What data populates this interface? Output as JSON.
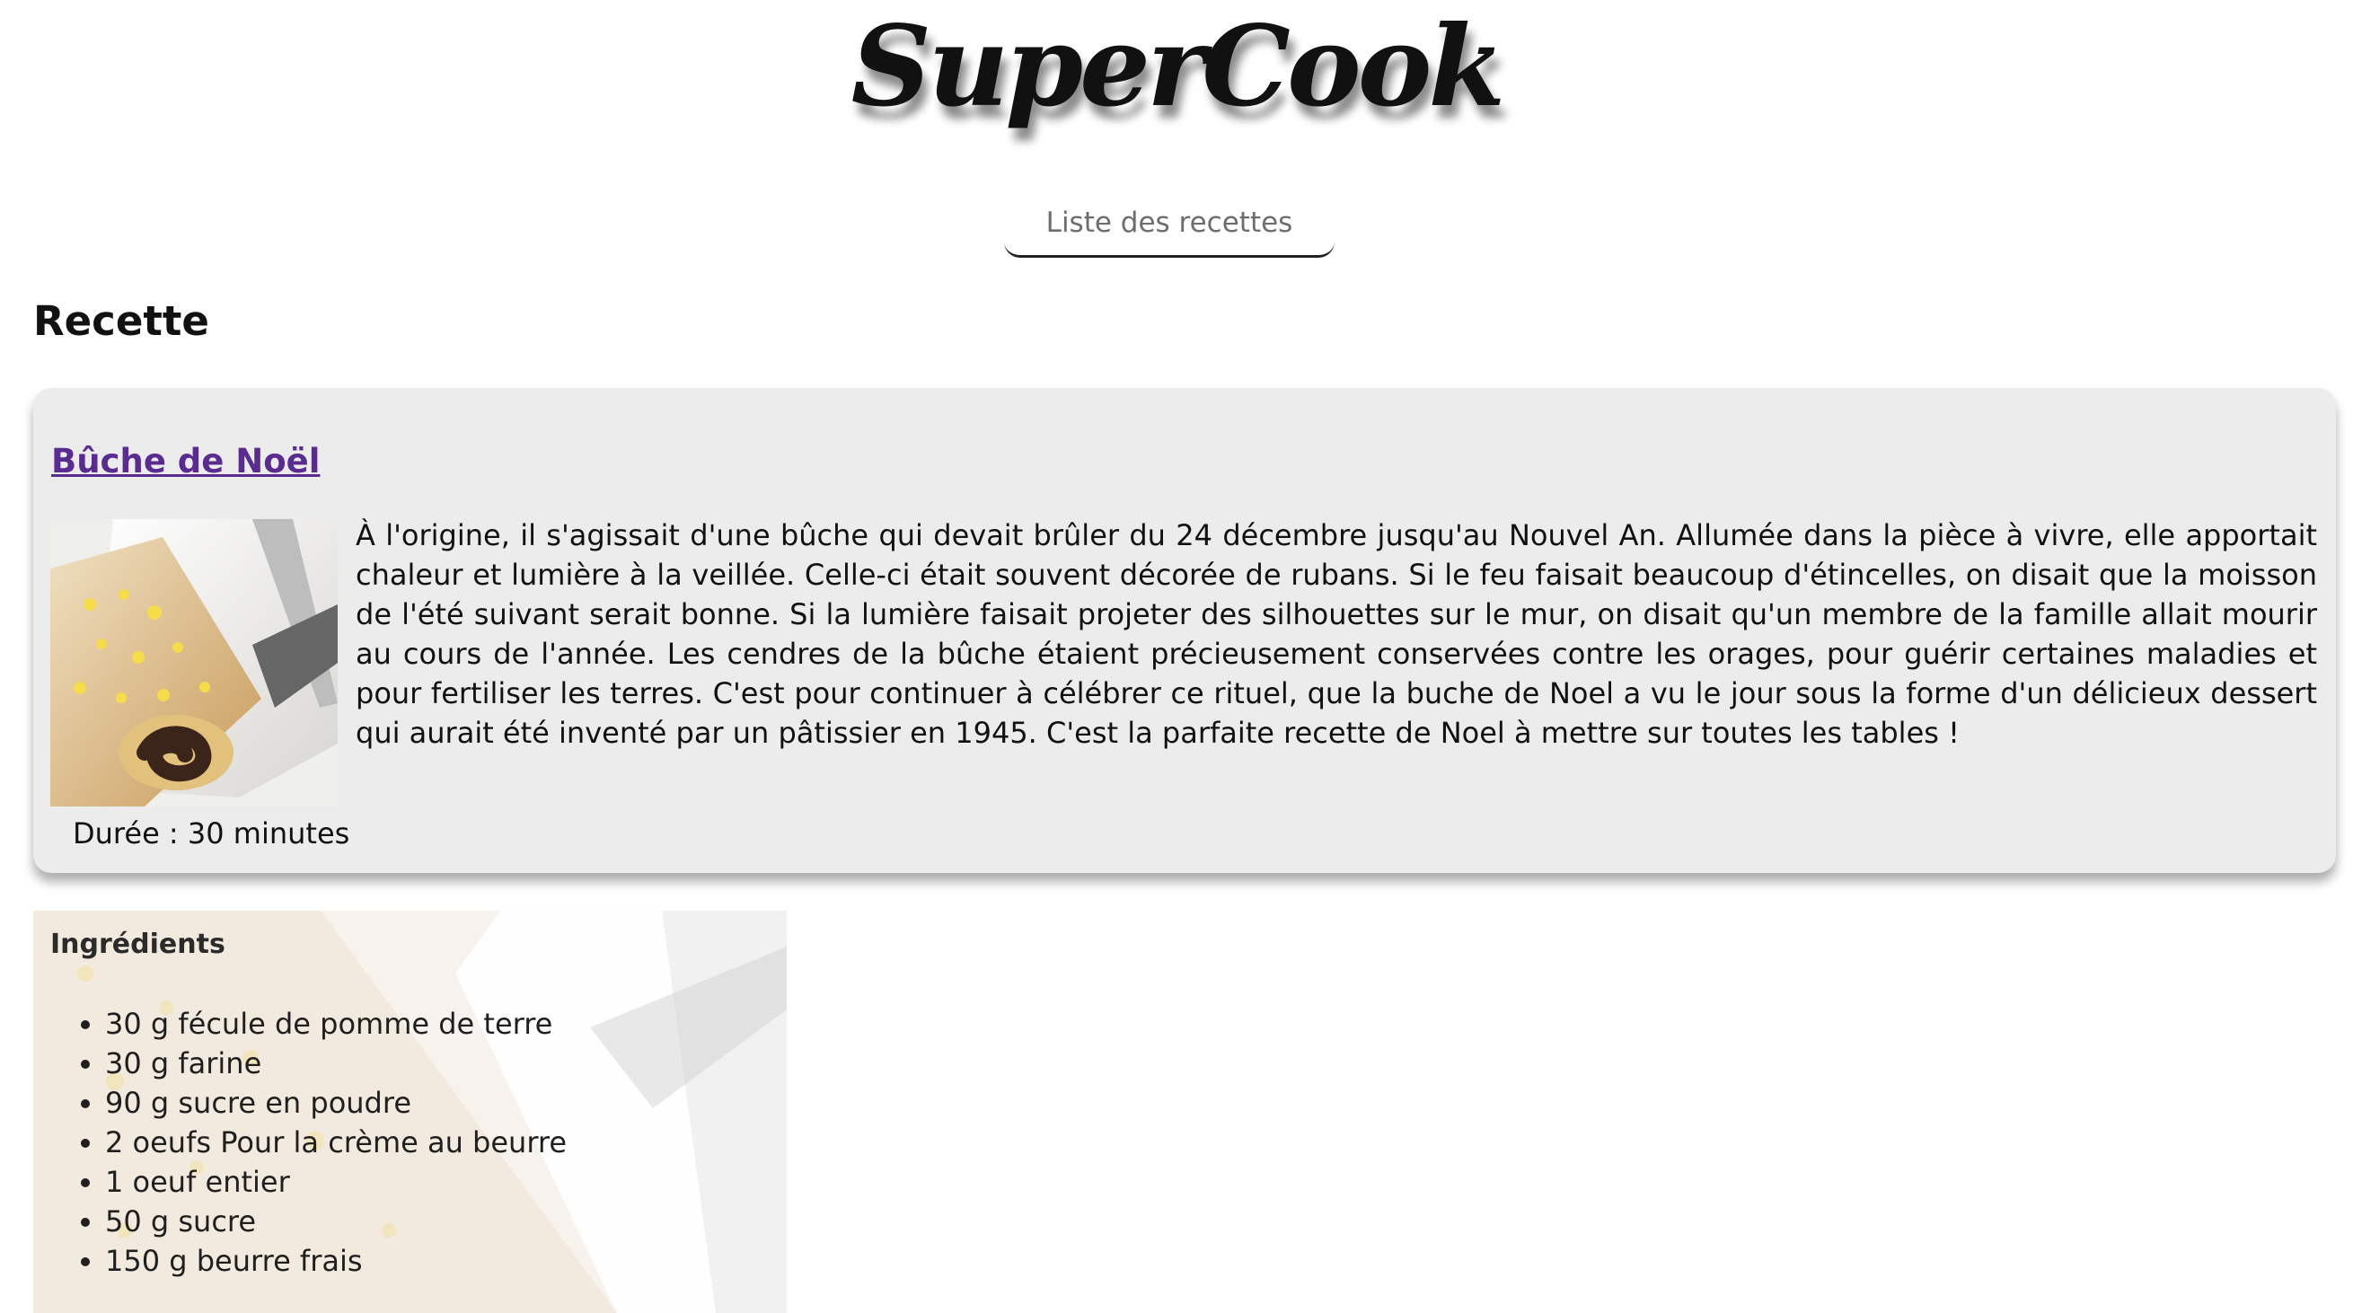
{
  "header": {
    "logo": "SuperCook",
    "nav_link": "Liste des recettes"
  },
  "main": {
    "section_title": "Recette",
    "recipe": {
      "name": "Bûche de Noël",
      "description": "À l'origine, il s'agissait d'une bûche qui devait brûler du 24 décembre jusqu'au Nouvel An. Allumée dans la pièce à vivre, elle apportait chaleur et lumière à la veillée. Celle-ci était souvent décorée de rubans. Si le feu faisait beaucoup d'étincelles, on disait que la moisson de l'été suivant serait bonne. Si la lumière faisait projeter des silhouettes sur le mur, on disait qu'un membre de la famille allait mourir au cours de l'année. Les cendres de la bûche étaient précieusement conservées contre les orages, pour guérir certaines maladies et pour fertiliser les terres. C'est pour continuer à célébrer ce rituel, que la buche de Noel a vu le jour sous la forme d'un délicieux dessert qui aurait été inventé par un pâtissier en 1945. C'est la parfaite recette de Noel à mettre sur toutes les tables !",
      "duration": "Durée : 30 minutes",
      "image_icon": "buche-photo-icon"
    },
    "ingredients": {
      "title": "Ingrédients",
      "items": [
        "30 g fécule de pomme de terre",
        "30 g farine",
        "90 g sucre en poudre",
        "2 oeufs Pour la crème au beurre",
        "1 oeuf entier",
        "50 g sucre",
        "150 g beurre frais"
      ]
    }
  },
  "colors": {
    "link": "#5b2c8f",
    "card_background": "#ececec",
    "nav_text": "#6d6d6d"
  }
}
